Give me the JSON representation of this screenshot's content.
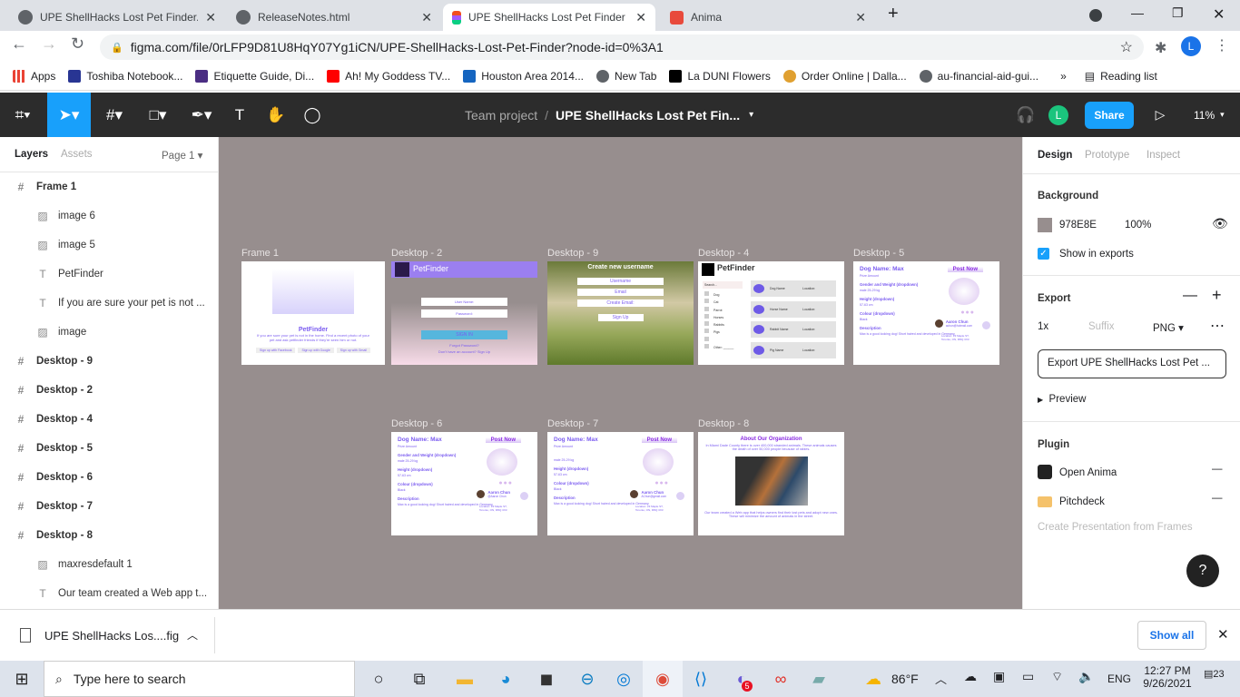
{
  "browser": {
    "tabs": [
      {
        "title": "UPE ShellHacks Lost Pet Finder.pdf",
        "icon": "globe-icon"
      },
      {
        "title": "ReleaseNotes.html",
        "icon": "globe-icon"
      },
      {
        "title": "UPE ShellHacks Lost Pet Finder – Figma",
        "icon": "figma-icon",
        "active": true
      },
      {
        "title": "Anima",
        "icon": "anima-icon"
      }
    ],
    "new_tab": "+",
    "url": "figma.com/file/0rLFP9D81U8HqY07Yg1iCN/UPE-ShellHacks-Lost-Pet-Finder?node-id=0%3A1",
    "profile_initial": "L",
    "bookmarks": [
      {
        "label": "Apps",
        "color": "#ea4335"
      },
      {
        "label": "Toshiba Notebook...",
        "color": "#283593"
      },
      {
        "label": "Etiquette Guide, Di...",
        "color": "#4b2e83"
      },
      {
        "label": "Ah! My Goddess TV...",
        "color": "#ff0000"
      },
      {
        "label": "Houston Area 2014...",
        "color": "#1565c0"
      },
      {
        "label": "New Tab",
        "color": "#5f6368"
      },
      {
        "label": "La DUNI Flowers",
        "color": "#000000"
      },
      {
        "label": "Order Online | Dalla...",
        "color": "#e0a030"
      },
      {
        "label": "au-financial-aid-gui...",
        "color": "#5f6368"
      }
    ],
    "more": "»",
    "reading_list": "Reading list"
  },
  "figma": {
    "breadcrumb_team": "Team project",
    "file_name": "UPE ShellHacks Lost Pet Fin...",
    "user_initial": "L",
    "user_color": "#1bc47d",
    "share": "Share",
    "zoom": "11%",
    "accent": "#18a0fb",
    "left_tabs": [
      "Layers",
      "Assets"
    ],
    "page": "Page 1",
    "layers": [
      {
        "name": "Frame 1",
        "type": "frame",
        "indent": 0
      },
      {
        "name": "image 6",
        "type": "image",
        "indent": 1
      },
      {
        "name": "image 5",
        "type": "image",
        "indent": 1
      },
      {
        "name": "PetFinder",
        "type": "text",
        "indent": 1
      },
      {
        "name": "If you are sure your pet is not ...",
        "type": "text",
        "indent": 1
      },
      {
        "name": "image",
        "type": "image",
        "indent": 1
      },
      {
        "name": "Desktop - 9",
        "type": "frame",
        "indent": 0
      },
      {
        "name": "Desktop - 2",
        "type": "frame",
        "indent": 0
      },
      {
        "name": "Desktop - 4",
        "type": "frame",
        "indent": 0
      },
      {
        "name": "Desktop - 5",
        "type": "frame",
        "indent": 0
      },
      {
        "name": "Desktop - 6",
        "type": "frame",
        "indent": 0
      },
      {
        "name": "Desktop - 7",
        "type": "frame",
        "indent": 0
      },
      {
        "name": "Desktop - 8",
        "type": "frame",
        "indent": 0
      },
      {
        "name": "maxresdefault 1",
        "type": "image",
        "indent": 1
      },
      {
        "name": "Our team created a Web app t...",
        "type": "text",
        "indent": 1
      }
    ],
    "canvas_bg": "#978E8E",
    "frames": {
      "f1": {
        "label": "Frame 1",
        "title": "PetFinder",
        "body": "If you are sure your pet is not in the home. Find a recent photo of your pet and ask petfinder friends if they're seen him or not.",
        "buttons": [
          "Sign up with Facebook",
          "Sign up with Google",
          "Sign up with Gmail"
        ]
      },
      "d2": {
        "label": "Desktop - 2",
        "title": "PetFinder",
        "user": "User Name:",
        "pass": "Password:",
        "signin": "SIGN IN",
        "forgot": "Forgot Password?",
        "signup": "Don't have an account? Sign Up"
      },
      "d9": {
        "label": "Desktop - 9",
        "title": "Create new username",
        "fields": [
          "Username",
          "Email",
          "Create Email:"
        ],
        "button": "Sign Up"
      },
      "d4": {
        "label": "Desktop - 4",
        "title": "PetFinder",
        "search": "Search...",
        "filters": [
          "Dog",
          "Cat",
          "Parrot",
          "Horses",
          "Rabbits",
          "Pigs",
          "",
          "Other: ______"
        ],
        "cards": [
          [
            "Dog Name",
            "Location:"
          ],
          [
            "Horse Name",
            "Location:"
          ],
          [
            "Rabbit Name",
            "Location:"
          ],
          [
            "Pig Name",
            "Location:"
          ]
        ]
      },
      "d5": {
        "label": "Desktop - 5",
        "dog": "Dog Name: Max",
        "prize": "Prize Amount",
        "gw": "Gender and Weight (dropdown)",
        "gwv": "male 25-29 kg",
        "h": "Height (dropdown)",
        "hv": "57-63 cm",
        "c": "Colour (dropdown)",
        "cv": "Black",
        "d": "Description",
        "dv": "Max is a good looking dog! Short haired and developed in Germany.",
        "post": "Post Now",
        "owner": "Aaron Chun",
        "contact": "achun@hotmail.com",
        "loc": "Location: 23 Maple ST, Toronto, ON, M5Q 3X3"
      },
      "d6": {
        "label": "Desktop - 6",
        "dog": "Dog Name: Max",
        "prize": "Prize Amount",
        "gw": "Gender and Weight (dropdown)",
        "gwv": "male 25-29 kg",
        "h": "Height (dropdown)",
        "hv": "57-63 cm",
        "c": "Colour (dropdown)",
        "cv": "Black",
        "d": "Description",
        "dv": "Max is a good looking dog! Short haired and developed in Germany.",
        "post": "Post Now",
        "owner": "Aaron Chun",
        "contact": "@Aaron Chun",
        "loc": "Location: 23 Maple ST, Toronto, ON, M5Q 3X3"
      },
      "d7": {
        "label": "Desktop - 7",
        "dog": "Dog Name: Max",
        "prize": "Prize Amount",
        "gwv": "male 25-29 kg",
        "h": "Height (dropdown)",
        "hv": "57-63 cm",
        "c": "Colour (dropdown)",
        "cv": "Black",
        "d": "Description",
        "dv": "Max is a good looking dog! Short haired and developed in Germany.",
        "post": "Post Now",
        "owner": "Aaron Chun",
        "contact": "AChun@gmail.com",
        "loc": "Location: 23 Maple ST, Toronto, ON, M5Q 3X3"
      },
      "d8": {
        "label": "Desktop - 8",
        "title": "About Our Organization",
        "p1": "In Miami Dade County there is over 400,000 stranded animals. These animals causes the death of over 50,000 people because of rabies.",
        "p2": "Our team created a Web app that helps owners find their lost pets and adopt new ones. These will minimize the amount of animals in the street."
      }
    },
    "right_tabs": [
      "Design",
      "Prototype",
      "Inspect"
    ],
    "background_label": "Background",
    "bg_hex": "978E8E",
    "bg_opacity": "100%",
    "show_exports": "Show in exports",
    "export_label": "Export",
    "export_scale": "1x",
    "suffix_placeholder": "Suffix",
    "format": "PNG",
    "export_button": "Export UPE ShellHacks Lost Pet ...",
    "preview": "Preview",
    "plugin_label": "Plugin",
    "plugins": [
      "Open Anima",
      "Pitchdeck"
    ],
    "plugin_hint": "Create Presentation from Frames",
    "help": "?"
  },
  "downloads": {
    "file": "UPE ShellHacks Los....fig",
    "show_all": "Show all"
  },
  "taskbar": {
    "search": "Type here to search",
    "weather": "86°F",
    "lang": "ENG",
    "time": "12:27 PM",
    "date": "9/26/2021",
    "notif": "23",
    "badge": "5"
  }
}
